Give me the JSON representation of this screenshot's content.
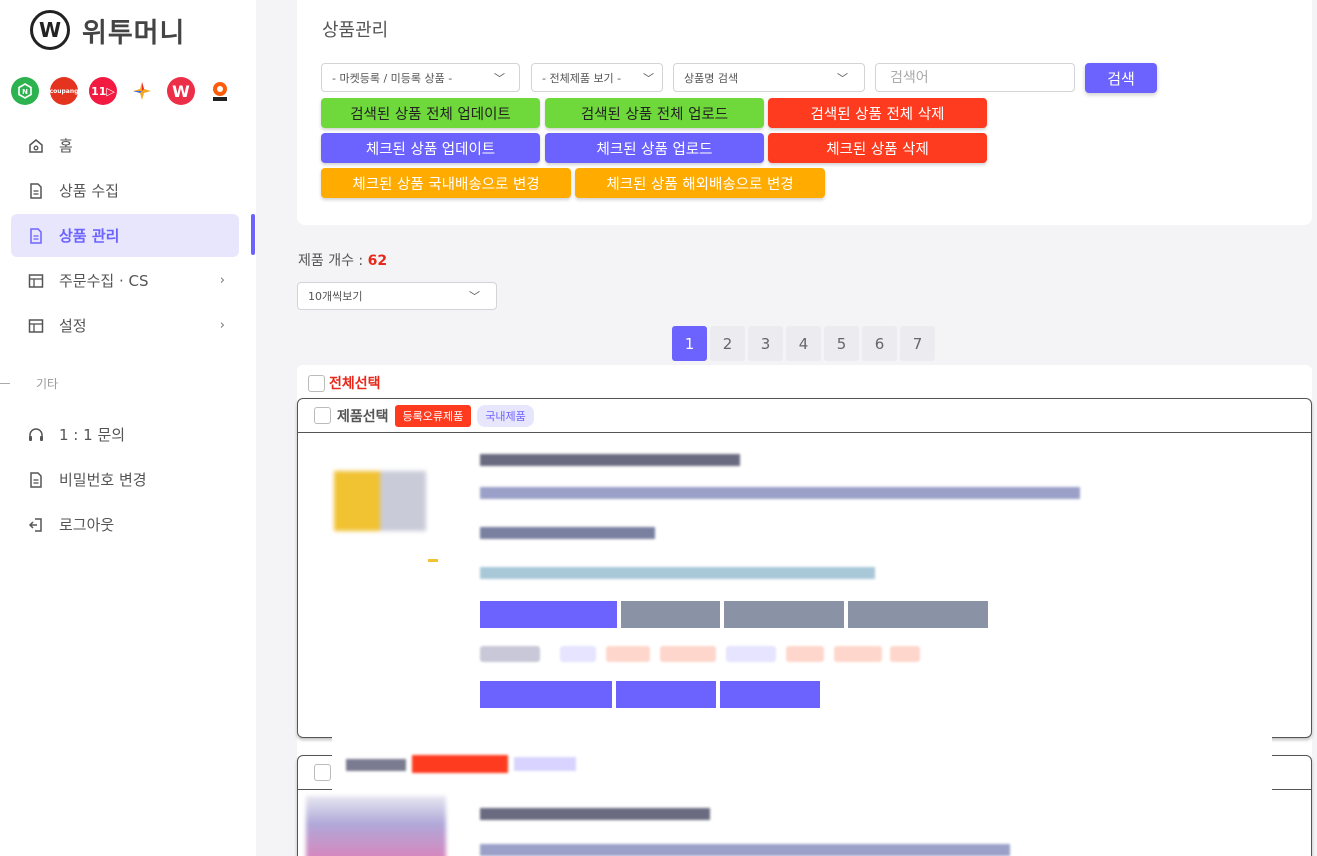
{
  "brand": {
    "logo_letter": "W",
    "name": "위투머니"
  },
  "markets": [
    {
      "icon": "smartstore-icon",
      "color": "#2cb24e",
      "label": "N"
    },
    {
      "icon": "coupang-icon",
      "color": "#e4341f",
      "label": "coupang"
    },
    {
      "icon": "11st-icon",
      "color": "#f21a40",
      "label": "11"
    },
    {
      "icon": "gmarket-icon",
      "color": "#ffffff",
      "label": "✦"
    },
    {
      "icon": "wemakeprice-icon",
      "color": "#ec2e48",
      "label": "W"
    },
    {
      "icon": "tmon-icon",
      "color": "#ff5c0a",
      "label": "◎"
    }
  ],
  "nav": {
    "items": [
      {
        "label": "홈",
        "icon": "home-icon"
      },
      {
        "label": "상품 수집",
        "icon": "document-icon"
      },
      {
        "label": "상품 관리",
        "icon": "document-icon",
        "active": true
      },
      {
        "label": "주문수집 · CS",
        "icon": "layout-icon",
        "has_arrow": true
      },
      {
        "label": "설정",
        "icon": "layout-icon",
        "has_arrow": true
      }
    ],
    "section_label": "기타",
    "items2": [
      {
        "label": "1 : 1 문의",
        "icon": "headset-icon"
      },
      {
        "label": "비밀번호 변경",
        "icon": "document-icon"
      },
      {
        "label": "로그아웃",
        "icon": "logout-icon"
      }
    ]
  },
  "card": {
    "title": "상품관리",
    "filter_market": "- 마켓등록 / 미등록 상품 -",
    "filter_view": "- 전체제품 보기 -",
    "filter_search_type": "상품명 검색",
    "search_placeholder": "검색어",
    "search_button": "검색",
    "actions": {
      "update_all": "검색된 상품 전체 업데이트",
      "upload_all": "검색된 상품 전체 업로드",
      "delete_all": "검색된 상품 전체 삭제",
      "update_checked": "체크된 상품 업데이트",
      "upload_checked": "체크된 상품 업로드",
      "delete_checked": "체크된 상품 삭제",
      "to_domestic": "체크된 상품 국내배송으로 변경",
      "to_overseas": "체크된 상품 해외배송으로 변경"
    }
  },
  "count": {
    "label": "제품 개수 :",
    "value": "62"
  },
  "per_page": "10개씩보기",
  "pagination": [
    "1",
    "2",
    "3",
    "4",
    "5",
    "6",
    "7"
  ],
  "list": {
    "select_all": "전체선택",
    "product": {
      "select_label": "제품선택",
      "error_badge": "등록오류제품",
      "domestic_badge": "국내제품"
    }
  },
  "colors": {
    "accent": "#6c63ff",
    "danger": "#ff3b1f",
    "success": "#6fd83a",
    "warning": "#ffab00"
  }
}
